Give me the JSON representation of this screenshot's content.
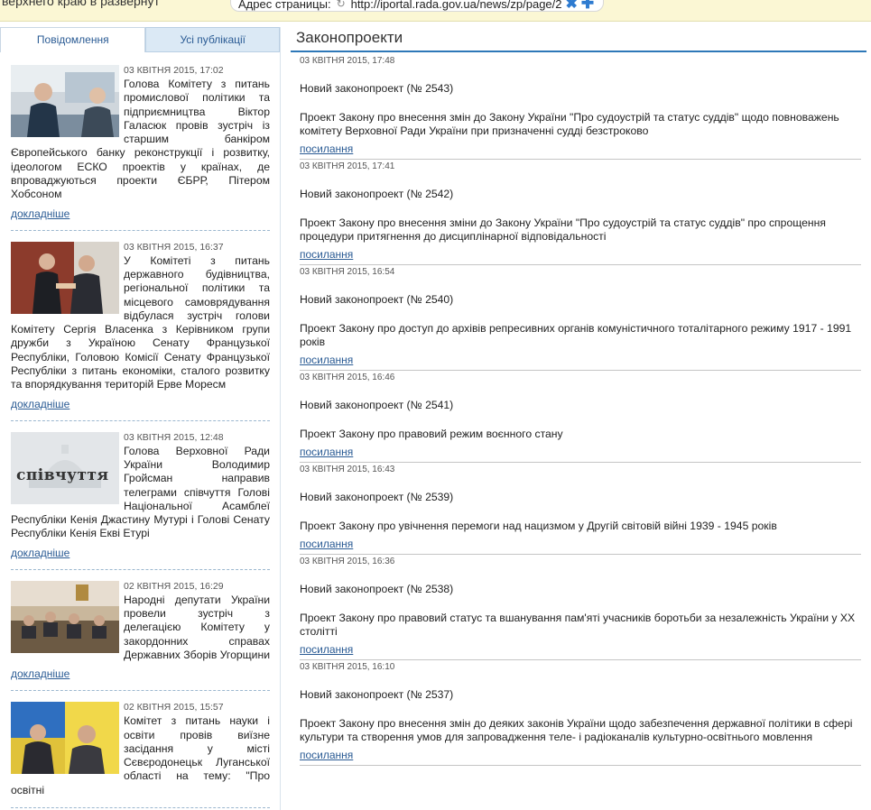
{
  "addressbar": {
    "cut_text": "верхнего краю в развернут",
    "label": "Адрес страницы:",
    "url": "http://iportal.rada.gov.ua/news/zp/page/2"
  },
  "tabs": [
    "Повідомлення",
    "Усі публікації"
  ],
  "news": [
    {
      "date": "03 КВІТНЯ 2015, 17:02",
      "text": "Голова Комітету з питань промислової політики та підприємництва Віктор Галасюк провів зустріч із старшим банкіром Європейського банку реконструкції і розвитку, ідеологом ЕСКО проектів у країнах, де впроваджуються проекти ЄБРР, Пітером Хобсоном",
      "more": "докладніше",
      "thumb": "meeting-photo"
    },
    {
      "date": "03 КВІТНЯ 2015, 16:37",
      "text": "У Комітеті з питань державного будівництва, регіональної політики та місцевого самоврядування відбулася зустріч голови Комітету Сергія Власенка з Керівником групи дружби з Україною Сенату Французької Республіки, Головою Комісії Сенату Французької Республіки з питань економіки, сталого розвитку та впорядкування територій Ерве Моресм",
      "more": "докладніше",
      "thumb": "handshake-photo"
    },
    {
      "date": "03 КВІТНЯ 2015, 12:48",
      "text": "Голова Верховної Ради України Володимир Гройсман направив телеграми співчуття Голові Національної Асамблеї Республіки Кенія Джастину Мутурі і Голові Сенату Республіки Кенія Екві Етурі",
      "more": "докладніше",
      "thumb": "condolence-image",
      "thumb_label": "співчуття"
    },
    {
      "date": "02 КВІТНЯ 2015, 16:29",
      "text": "Народні депутати України провели зустріч з делегацією Комітету у закордонних справах Державних Зборів Угорщини",
      "more": "докладніше",
      "thumb": "delegation-photo"
    },
    {
      "date": "02 КВІТНЯ 2015, 15:57",
      "text": "Комітет з питань науки і освіти провів виїзне засідання у місті Сєвєродонецьк Луганської області на тему: \"Про освітні",
      "more": "",
      "thumb": "session-photo"
    }
  ],
  "bills_section": {
    "title": "Законопроекти",
    "items": [
      {
        "date": "03 КВІТНЯ 2015, 17:48",
        "head": "Новий законопроект (№ 2543)",
        "desc": "Проект Закону про внесення змін до Закону України \"Про судоустрій та статус суддів\" щодо повноважень комітету Верховної Ради України при призначенні судді безстроково",
        "link": "посилання"
      },
      {
        "date": "03 КВІТНЯ 2015, 17:41",
        "head": "Новий законопроект (№ 2542)",
        "desc": "Проект Закону про внесення зміни до Закону України \"Про судоустрій та статус суддів\" про спрощення процедури притягнення до дисциплінарної відповідальності",
        "link": "посилання"
      },
      {
        "date": "03 КВІТНЯ 2015, 16:54",
        "head": "Новий законопроект (№ 2540)",
        "desc": "Проект Закону про доступ до архівів репресивних органів комуністичного тоталітарного режиму 1917 - 1991 років",
        "link": "посилання"
      },
      {
        "date": "03 КВІТНЯ 2015, 16:46",
        "head": "Новий законопроект (№ 2541)",
        "desc": "Проект Закону про правовий режим воєнного стану",
        "link": "посилання"
      },
      {
        "date": "03 КВІТНЯ 2015, 16:43",
        "head": "Новий законопроект (№ 2539)",
        "desc": "Проект Закону про увічнення перемоги над нацизмом у Другій світовій війні 1939 - 1945 років",
        "link": "посилання"
      },
      {
        "date": "03 КВІТНЯ 2015, 16:36",
        "head": "Новий законопроект (№ 2538)",
        "desc": "Проект Закону про правовий статус та вшанування пам'яті учасників боротьби за незалежність України у XX столітті",
        "link": "посилання"
      },
      {
        "date": "03 КВІТНЯ 2015, 16:10",
        "head": "Новий законопроект (№ 2537)",
        "desc": "Проект Закону про внесення змін до деяких законів України щодо забезпечення державної політики в сфері культури та створення умов для запровадження теле- і радіоканалів культурно-освітнього мовлення",
        "link": "посилання"
      }
    ]
  },
  "colors": {
    "link": "#2a5b94",
    "accent": "#2e78b8",
    "tab_inactive_bg": "#dbe9f5",
    "topbar_bg": "#fbf7d4"
  }
}
